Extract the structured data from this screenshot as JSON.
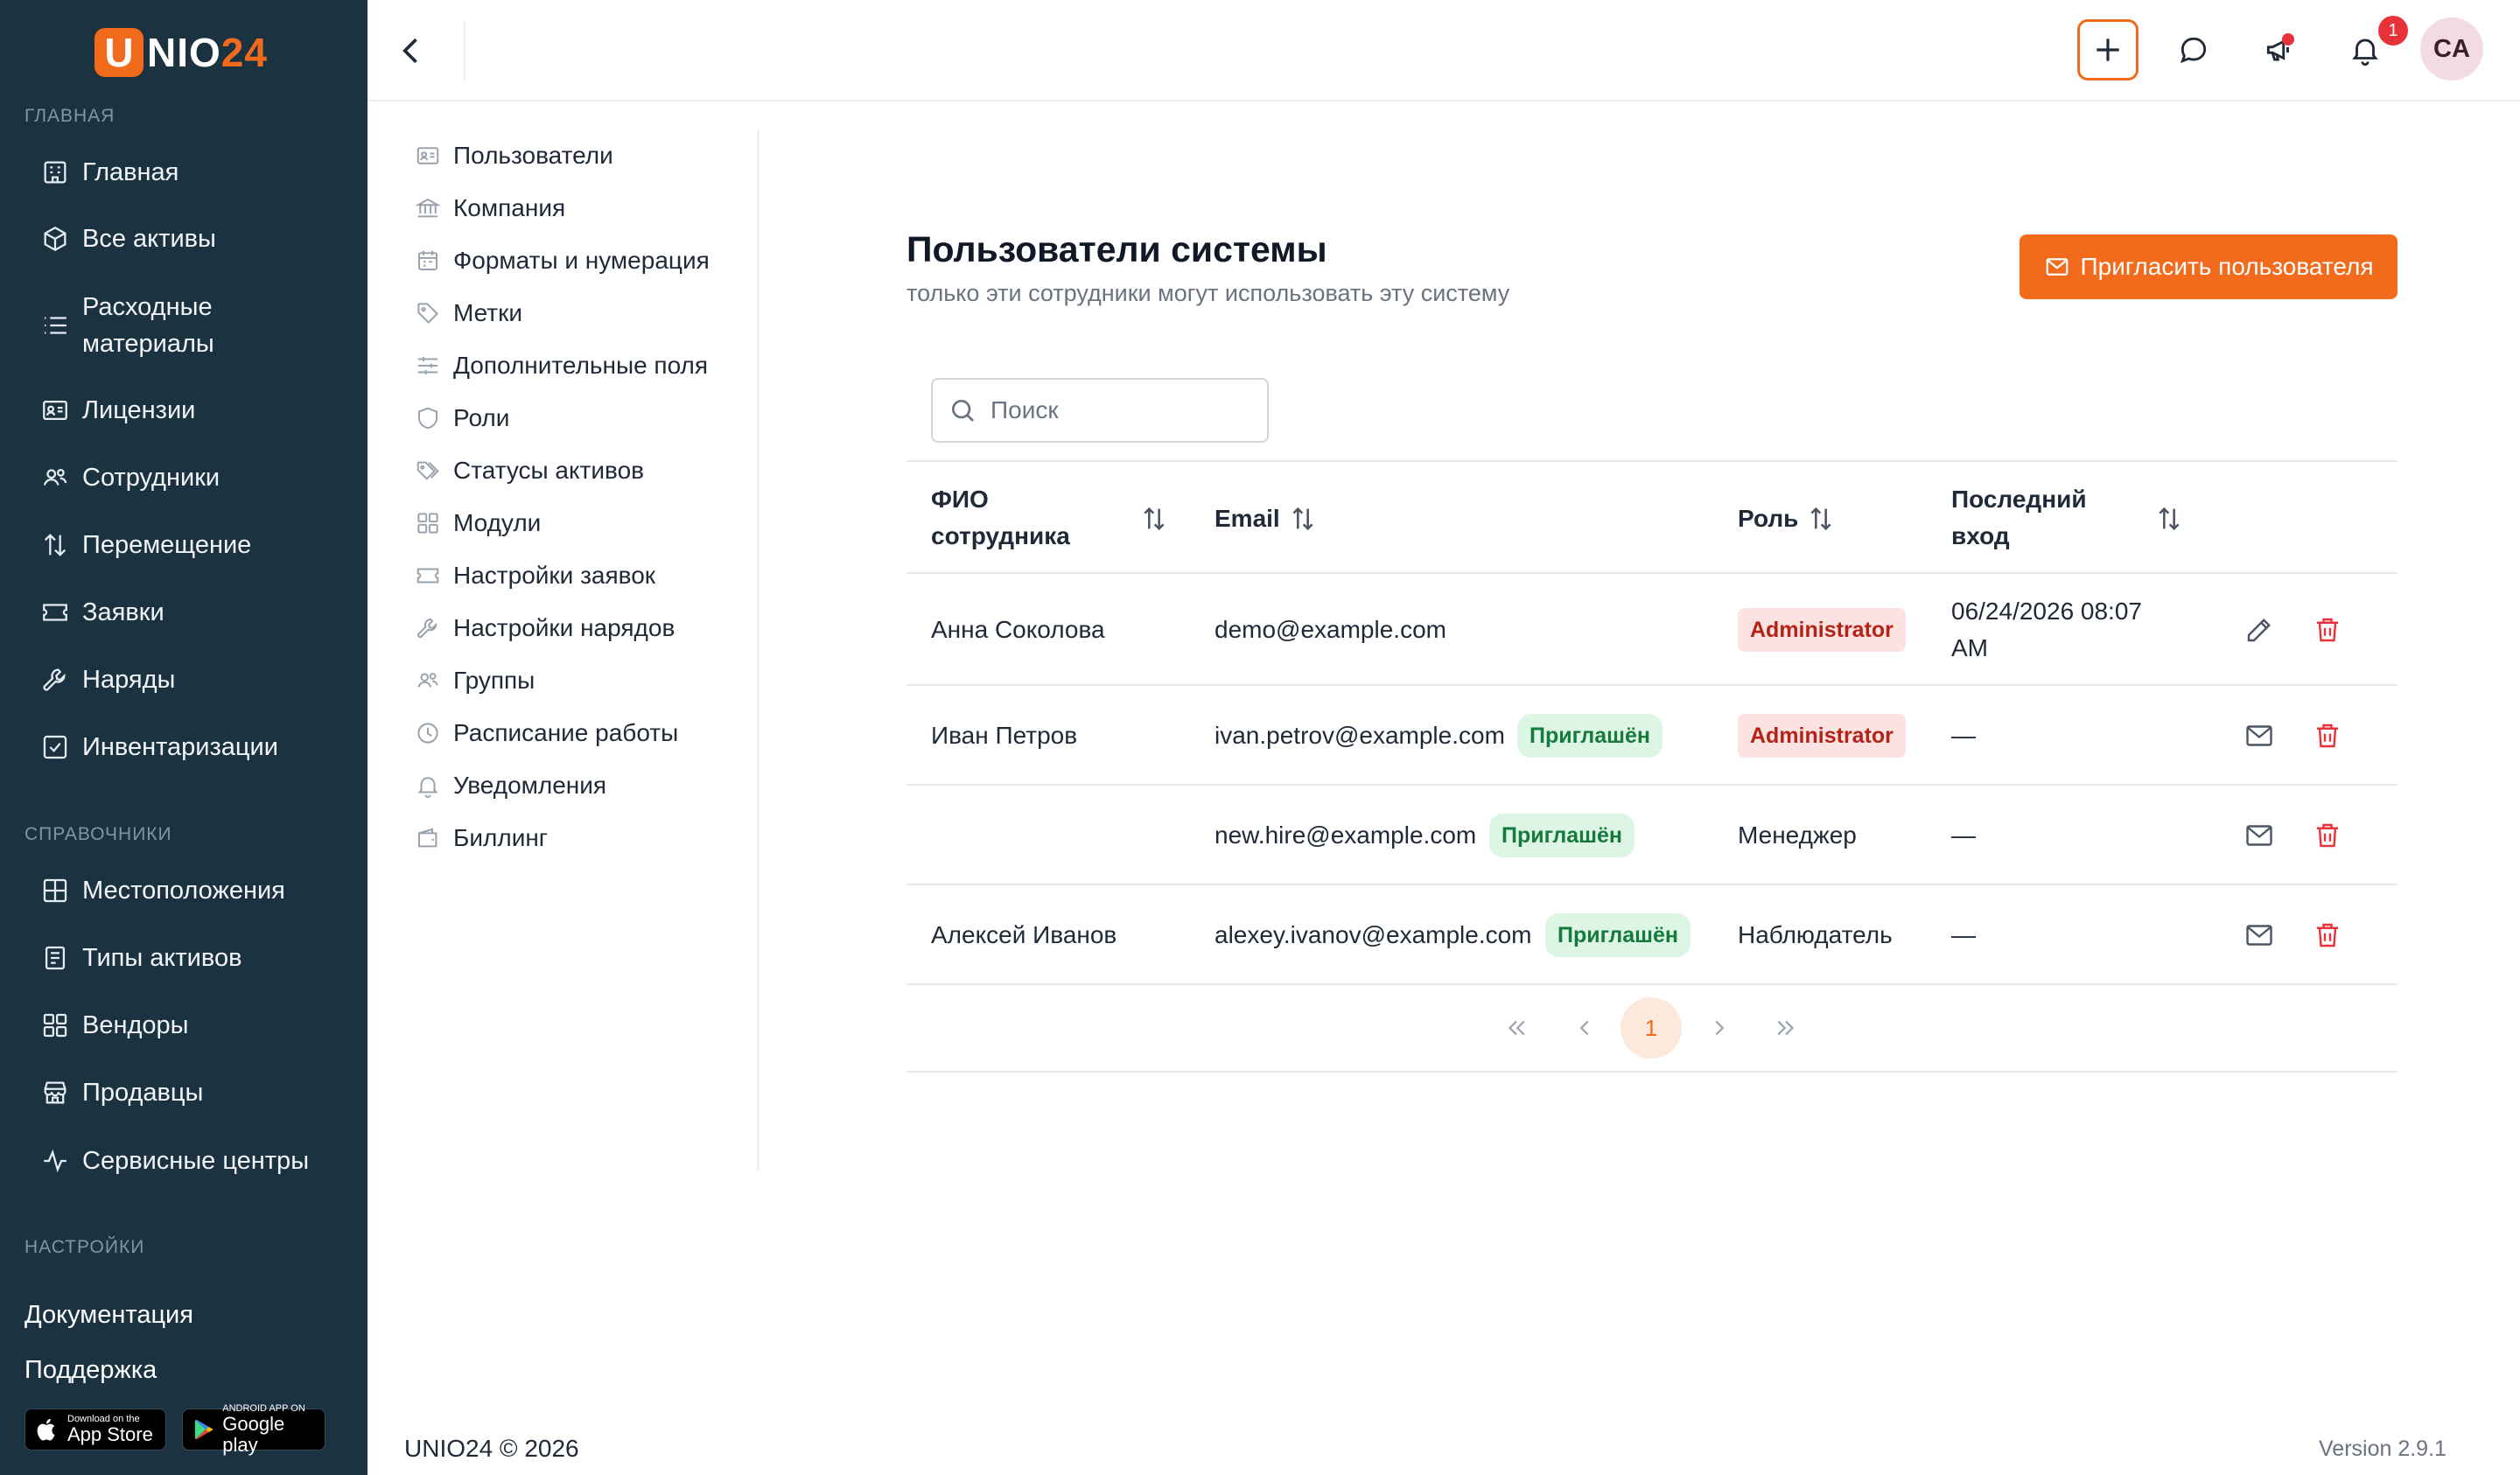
{
  "brand": {
    "u": "U",
    "nio": "NIO",
    "n24": "24"
  },
  "sidebar": {
    "section_main": "ГЛАВНАЯ",
    "main_items": [
      {
        "label": "Главная",
        "icon": "building-icon"
      },
      {
        "label": "Все активы",
        "icon": "cube-icon"
      },
      {
        "label": "Расходные материалы",
        "icon": "list-icon"
      },
      {
        "label": "Лицензии",
        "icon": "id-card-icon"
      },
      {
        "label": "Сотрудники",
        "icon": "users-icon"
      },
      {
        "label": "Перемещение",
        "icon": "arrows-updown-icon"
      },
      {
        "label": "Заявки",
        "icon": "ticket-icon"
      },
      {
        "label": "Наряды",
        "icon": "wrench-icon"
      },
      {
        "label": "Инвентаризации",
        "icon": "checkbox-icon"
      }
    ],
    "section_refs": "СПРАВОЧНИКИ",
    "ref_items": [
      {
        "label": "Местоположения",
        "icon": "grid-icon"
      },
      {
        "label": "Типы активов",
        "icon": "document-icon"
      },
      {
        "label": "Вендоры",
        "icon": "apps-icon"
      },
      {
        "label": "Продавцы",
        "icon": "store-icon"
      },
      {
        "label": "Сервисные центры",
        "icon": "activity-icon"
      }
    ],
    "section_settings": "НАСТРОЙКИ",
    "docs": "Документация",
    "support": "Поддержка",
    "app_store_small": "Download on the",
    "app_store_big": "App Store",
    "google_small": "ANDROID APP ON",
    "google_big": "Google play"
  },
  "header": {
    "notification_count": "1",
    "avatar_initials": "CA"
  },
  "settings_menu": [
    {
      "label": "Пользователи",
      "icon": "user-card-icon"
    },
    {
      "label": "Компания",
      "icon": "bank-icon"
    },
    {
      "label": "Форматы и нумерация",
      "icon": "calendar-icon"
    },
    {
      "label": "Метки",
      "icon": "tag-icon"
    },
    {
      "label": "Дополнительные поля",
      "icon": "sliders-icon"
    },
    {
      "label": "Роли",
      "icon": "shield-icon"
    },
    {
      "label": "Статусы активов",
      "icon": "tags-icon"
    },
    {
      "label": "Модули",
      "icon": "modules-icon"
    },
    {
      "label": "Настройки заявок",
      "icon": "ticket-icon"
    },
    {
      "label": "Настройки нарядов",
      "icon": "wrench-icon"
    },
    {
      "label": "Группы",
      "icon": "group-icon"
    },
    {
      "label": "Расписание работы",
      "icon": "clock-icon"
    },
    {
      "label": "Уведомления",
      "icon": "bell-icon"
    },
    {
      "label": "Биллинг",
      "icon": "wallet-icon"
    }
  ],
  "page": {
    "title": "Пользователи системы",
    "subtitle": "только эти сотрудники могут использовать эту систему",
    "invite_button": "Пригласить пользователя",
    "search_placeholder": "Поиск"
  },
  "table": {
    "headers": {
      "name_line1": "ФИО",
      "name_line2": "сотрудника",
      "email": "Email",
      "role": "Роль",
      "last_line1": "Последний",
      "last_line2": "вход"
    },
    "rows": [
      {
        "name": "Анна Соколова",
        "email": "demo@example.com",
        "status": "",
        "role": "Administrator",
        "role_badge": true,
        "last_login_1": "06/24/2026 08:07",
        "last_login_2": "AM",
        "action": "edit-icon"
      },
      {
        "name": "Иван Петров",
        "email": "ivan.petrov@example.com",
        "status": "Приглашён",
        "role": "Administrator",
        "role_badge": true,
        "last_login_1": "—",
        "last_login_2": "",
        "action": "mail-icon"
      },
      {
        "name": "",
        "email": "new.hire@example.com",
        "status": "Приглашён",
        "role": "Менеджер",
        "role_badge": false,
        "last_login_1": "—",
        "last_login_2": "",
        "action": "mail-icon"
      },
      {
        "name": "Алексей Иванов",
        "email": "alexey.ivanov@example.com",
        "status": "Приглашён",
        "role": "Наблюдатель",
        "role_badge": false,
        "last_login_1": "—",
        "last_login_2": "",
        "action": "mail-icon"
      }
    ]
  },
  "pagination": {
    "current_page": "1"
  },
  "footer": {
    "copyright": "UNIO24 © 2026",
    "version": "Version 2.9.1"
  },
  "colors": {
    "sidebar_bg": "#1b3241",
    "accent": "#f26b1d",
    "invited_bg": "#dcf5e4",
    "invited_text": "#157a3c",
    "admin_bg": "#fde2e2",
    "admin_text": "#b42318",
    "danger": "#e8323a"
  }
}
